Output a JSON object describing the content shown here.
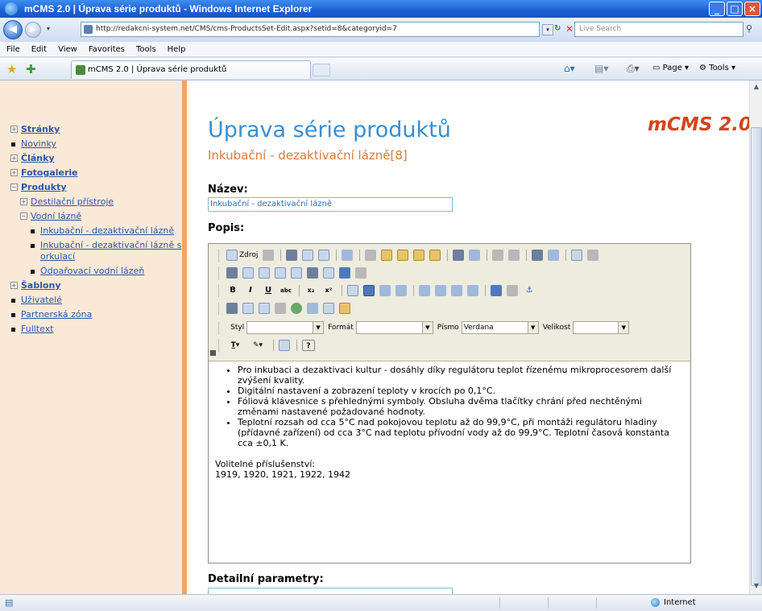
{
  "window": {
    "title": "mCMS 2.0 | Úprava série produktů - Windows Internet Explorer",
    "minimize": "_",
    "maximize": "□",
    "close": "×"
  },
  "addressbar": {
    "back": "◀",
    "forward": "▶",
    "url": "http://redakcni-system.net/CMS/cms-ProductsSet-Edit.aspx?setid=8&categoryid=7",
    "search_placeholder": "Live Search"
  },
  "menu": [
    "File",
    "Edit",
    "View",
    "Favorites",
    "Tools",
    "Help"
  ],
  "tab": {
    "title": "mCMS 2.0 | Úprava série produktů",
    "page_label": "Page",
    "tools_label": "Tools"
  },
  "sidebar": {
    "items": [
      {
        "label": "Stránky",
        "marker": "+",
        "bold": true,
        "level": 0
      },
      {
        "label": "Novinky",
        "marker": "■",
        "bold": false,
        "level": 0
      },
      {
        "label": "Články",
        "marker": "+",
        "bold": true,
        "level": 0
      },
      {
        "label": "Fotogalerie",
        "marker": "+",
        "bold": true,
        "level": 0
      },
      {
        "label": "Produkty",
        "marker": "−",
        "bold": true,
        "level": 0
      },
      {
        "label": "Destilační přístroje",
        "marker": "+",
        "bold": false,
        "level": 1
      },
      {
        "label": "Vodní lázně",
        "marker": "−",
        "bold": false,
        "level": 1
      },
      {
        "label": "Inkubační - dezaktivační lázně",
        "marker": "■",
        "bold": false,
        "level": 2
      },
      {
        "label": "Inkubační - dezaktivační lázně s orkulací",
        "marker": "■",
        "bold": false,
        "level": 2
      },
      {
        "label": "Odpařovací vodní lázeň",
        "marker": "■",
        "bold": false,
        "level": 2
      },
      {
        "label": "Šablony",
        "marker": "+",
        "bold": true,
        "level": 0
      },
      {
        "label": "Uživatelé",
        "marker": "■",
        "bold": false,
        "level": 0
      },
      {
        "label": "Partnerská zóna",
        "marker": "■",
        "bold": false,
        "level": 0
      },
      {
        "label": "Fulltext",
        "marker": "■",
        "bold": false,
        "level": 0
      }
    ]
  },
  "main": {
    "heading": "Úprava série produktů",
    "subheading": "Inkubační - dezaktivační lázně[8]",
    "logo": "mCMS 2.0",
    "name_label": "Název:",
    "name_value": "Inkubační - dezaktivační lázně",
    "desc_label": "Popis:",
    "detail_label": "Detailní parametry:"
  },
  "editor": {
    "toolbar": {
      "source_label": "Zdroj",
      "style_label": "Styl",
      "format_label": "Formát",
      "font_label": "Písmo",
      "font_value": "Verdana",
      "size_label": "Velikost",
      "style_value": "",
      "format_value": "",
      "size_value": ""
    },
    "bullets": [
      "Pro inkubaci a dezaktivaci kultur - dosáhly díky regulátoru teplot řízenému mikroprocesorem další zvýšení kvality.",
      "Digitální nastavení a zobrazení teploty v krocích po 0,1°C.",
      "Fóliová klávesnice s přehlednými symboly. Obsluha dvěma tlačítky chrání před nechtěnými změnami nastavené požadované hodnoty.",
      "Teplotní rozsah od cca 5°C nad pokojovou teplotu až do 99,9°C, při montáži regulátoru hladiny (přídavné zařízení) od cca 3°C nad teplotu přívodní vody až do 99,9°C. Teplotní časová konstanta cca ±0,1 K."
    ],
    "accessories_label": "Volitelné příslušenství:",
    "accessories_value": "1919, 1920, 1921, 1922, 1942"
  },
  "status": {
    "zone": "Internet"
  }
}
